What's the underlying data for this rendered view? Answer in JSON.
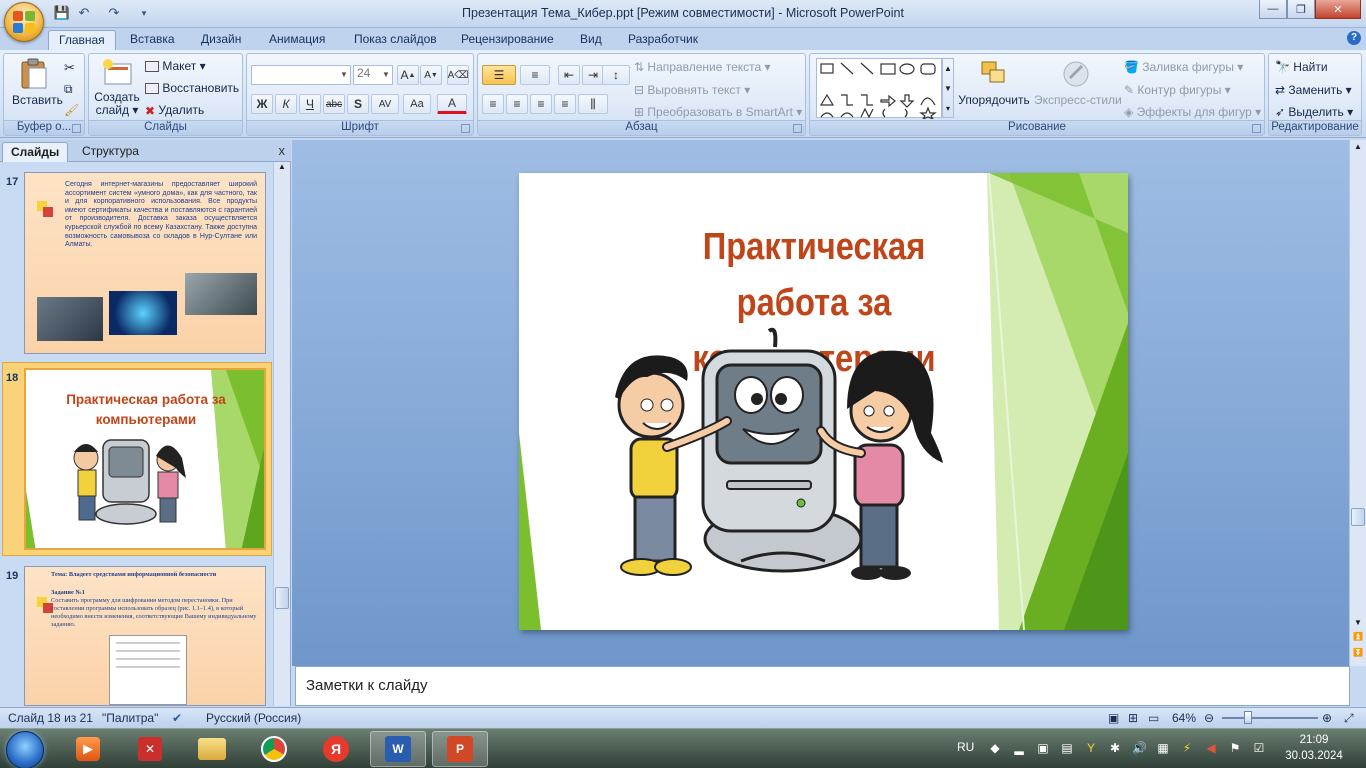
{
  "window": {
    "title": "Презентация Тема_Кибер.ppt [Режим совместимости] - Microsoft PowerPoint",
    "minimize": "—",
    "restore": "❐",
    "close": "✕"
  },
  "tabs": [
    "Главная",
    "Вставка",
    "Дизайн",
    "Анимация",
    "Показ слайдов",
    "Рецензирование",
    "Вид",
    "Разработчик"
  ],
  "help_icon": "?",
  "ribbon": {
    "clipboard": {
      "label": "Буфер о...",
      "paste": "Вставить"
    },
    "slides": {
      "label": "Слайды",
      "new_slide_1": "Создать",
      "new_slide_2": "слайд ▾",
      "layout": "Макет ▾",
      "reset": "Восстановить",
      "delete": "Удалить"
    },
    "font": {
      "label": "Шрифт",
      "font_name": "",
      "font_size": "24",
      "bold": "Ж",
      "italic": "К",
      "underline": "Ч",
      "strike": "abc",
      "shadow": "S",
      "spacing": "AV",
      "case": "Aa",
      "color": "A"
    },
    "paragraph": {
      "label": "Абзац",
      "text_direction": "Направление текста ▾",
      "align_text": "Выровнять текст ▾",
      "smartart": "Преобразовать в SmartArt ▾"
    },
    "drawing": {
      "label": "Рисование",
      "arrange": "Упорядочить",
      "quick_styles": "Экспресс-стили",
      "fill": "Заливка фигуры ▾",
      "outline": "Контур фигуры ▾",
      "effects": "Эффекты для фигур ▾"
    },
    "editing": {
      "label": "Редактирование",
      "find": "Найти",
      "replace": "Заменить ▾",
      "select": "Выделить ▾"
    }
  },
  "pane": {
    "tab_slides": "Слайды",
    "tab_outline": "Структура",
    "close": "x",
    "thumbs": [
      {
        "num": "17",
        "text": "Сегодня интернет-магазины предоставляет широкий ассортимент систем «умного дома», как для частного, так и для корпоративного использования. Все продукты имеют сертификаты качества и поставляются с гарантией от производителя. Доставка заказа осуществляется курьерской службой по всему Казахстану. Также доступна возможность самовывоза со складов в Нур-Султане или Алматы."
      },
      {
        "num": "18",
        "title": "Практическая работа за компьютерами"
      },
      {
        "num": "19",
        "line1": "Тема: Владеет средствами информационной безопасности",
        "line2": "Задание №1",
        "line3": "Составить программу для шифрования методом перестановки. При составлении программы использовать образец (рис. 1.1–1.4), в который необходимо внести изменения, соответствующие Вашему индивидуальному заданию."
      }
    ]
  },
  "slide": {
    "title_line1": "Практическая работа за",
    "title_line2": "компьютерами"
  },
  "notes": {
    "placeholder": "Заметки к слайду"
  },
  "status": {
    "slide_counter": "Слайд 18 из 21",
    "theme": "\"Палитра\"",
    "language": "Русский (Россия)",
    "zoom": "64%"
  },
  "taskbar": {
    "lang": "RU",
    "time": "21:09",
    "date": "30.03.2024"
  },
  "colors": {
    "title_orange": "#c0461a",
    "slide_green": "#7cbf2e",
    "ribbon_bg": "#d4e2f5",
    "selected_thumb": "#f3b443"
  }
}
